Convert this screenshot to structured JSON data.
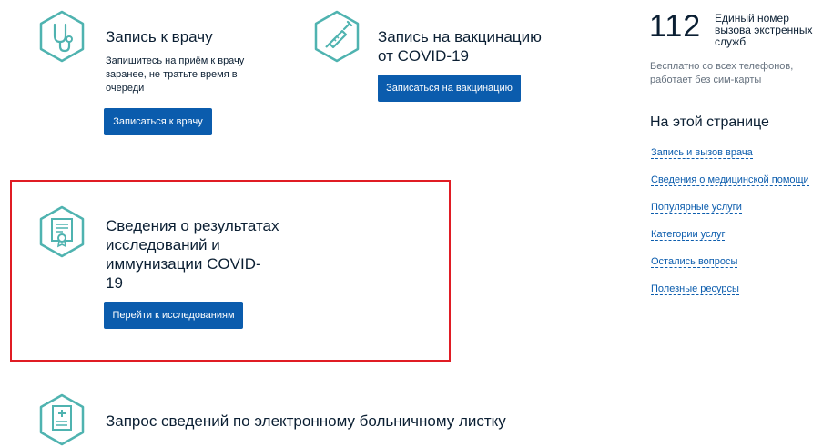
{
  "cards": {
    "doctor": {
      "title": "Запись к врачу",
      "desc_line1": "Запишитесь на приём к врачу",
      "desc_line2": "заранее, не тратьте время в",
      "desc_line3": "очереди",
      "button": "Записаться к врачу",
      "icon": "stethoscope-icon"
    },
    "vaccine": {
      "title_line1": "Запись на вакцинацию",
      "title_line2": "от COVID-19",
      "button": "Записаться на вакцинацию",
      "icon": "syringe-icon"
    },
    "results": {
      "title_line1": "Сведения о результатах",
      "title_line2": "исследований и",
      "title_line3": "иммунизации COVID-",
      "title_line4": "19",
      "button": "Перейти к исследованиям",
      "icon": "certificate-icon"
    },
    "sick_leave": {
      "title": "Запрос сведений по электронному больничному листку",
      "icon": "medical-document-icon"
    }
  },
  "emergency": {
    "number": "112",
    "label_line1": "Единый номер",
    "label_line2": "вызова экстренных",
    "label_line3": "служб",
    "note_line1": "Бесплатно со всех телефонов,",
    "note_line2": "работает без сим-карты"
  },
  "toc": {
    "title": "На этой странице",
    "links": [
      "Запись и вызов врача",
      "Сведения о медицинской помощи",
      "Популярные услуги",
      "Категории услуг",
      "Остались вопросы",
      "Полезные ресурсы"
    ]
  },
  "colors": {
    "accent": "#0b5cad",
    "icon_teal": "#4fb3b0",
    "highlight": "#e01c24"
  }
}
